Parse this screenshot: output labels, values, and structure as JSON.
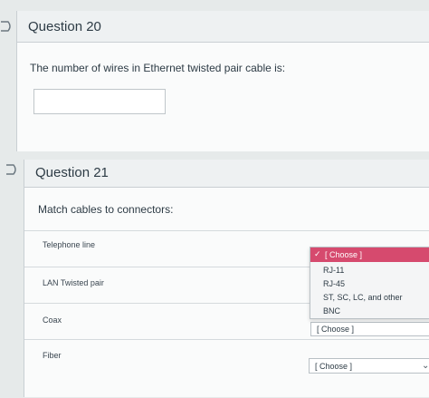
{
  "question20": {
    "title": "Question 20",
    "text": "The number of wires in Ethernet twisted pair cable is:",
    "answer": ""
  },
  "question21": {
    "title": "Question 21",
    "text": "Match cables to connectors:",
    "rows": [
      {
        "label": "Telephone line",
        "selected": "[ Choose ]"
      },
      {
        "label": "LAN Twisted pair",
        "selected": "[ Choose ]"
      },
      {
        "label": "Coax",
        "selected": "[ Choose ]"
      },
      {
        "label": "Fiber",
        "selected": "[ Choose ]"
      }
    ],
    "dropdown": {
      "selected_mark": "✓",
      "options": [
        "[ Choose ]",
        "RJ-11",
        "RJ-45",
        "ST, SC, LC, and other",
        "BNC"
      ]
    }
  },
  "colors": {
    "highlight": "#d64a6e"
  }
}
